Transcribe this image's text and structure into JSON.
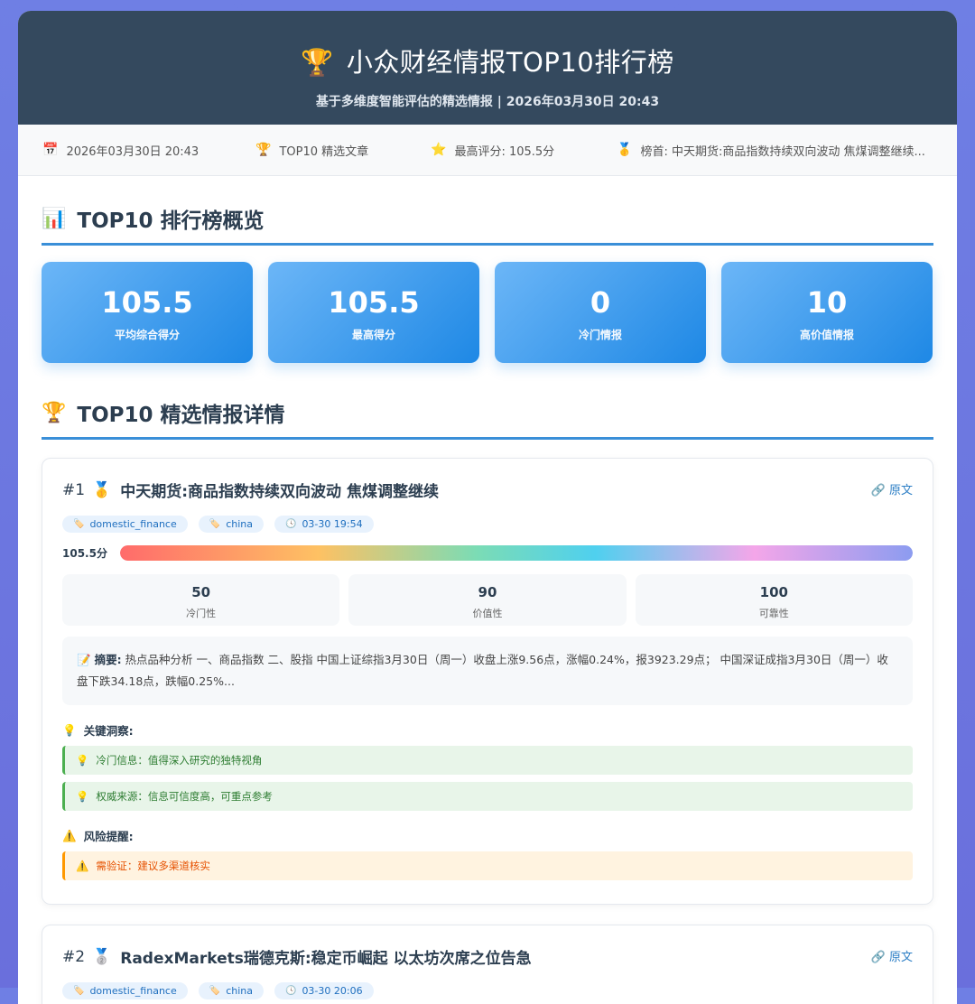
{
  "header": {
    "trophy_emoji": "🏆",
    "title": "小众财经情报TOP10排行榜",
    "subtitle": "基于多维度智能评估的精选情报 | 2026年03月30日 20:43"
  },
  "statbar": [
    {
      "icon": "📅",
      "icon_name": "calendar-icon",
      "text": "2026年03月30日 20:43"
    },
    {
      "icon": "🏆",
      "icon_name": "trophy-icon",
      "text": "TOP10 精选文章"
    },
    {
      "icon": "⭐",
      "icon_name": "star-icon",
      "text": "最高评分: 105.5分"
    },
    {
      "icon": "🥇",
      "icon_name": "medal-icon",
      "text": "榜首: 中天期货:商品指数持续双向波动 焦煤调整继续..."
    }
  ],
  "overview": {
    "icon": "📊",
    "title": "TOP10 排行榜概览",
    "cards": [
      {
        "value": "105.5",
        "label": "平均综合得分"
      },
      {
        "value": "105.5",
        "label": "最高得分"
      },
      {
        "value": "0",
        "label": "冷门情报"
      },
      {
        "value": "10",
        "label": "高价值情报"
      }
    ]
  },
  "details": {
    "icon": "🏆",
    "title": "TOP10 精选情报详情"
  },
  "articles": [
    {
      "rank": "#1",
      "medal": "🥇",
      "title": "中天期货:商品指数持续双向波动 焦煤调整继续",
      "link_label": "原文",
      "tags": [
        "domestic_finance",
        "china"
      ],
      "time": "03-30 19:54",
      "score_label": "105.5分",
      "score_fraction": 1.0,
      "metrics": [
        {
          "value": "50",
          "label": "冷门性"
        },
        {
          "value": "90",
          "label": "价值性"
        },
        {
          "value": "100",
          "label": "可靠性"
        }
      ],
      "summary_label": "摘要:",
      "summary": "热点品种分析 一、商品指数 二、股指 中国上证综指3月30日（周一）收盘上涨9.56点，涨幅0.24%，报3923.29点； 中国深证成指3月30日（周一）收盘下跌34.18点，跌幅0.25%...",
      "insights_title": "关键洞察:",
      "insights": [
        "冷门信息：值得深入研究的独特视角",
        "权威来源：信息可信度高，可重点参考"
      ],
      "risks_title": "风险提醒:",
      "risks": [
        "需验证：建议多渠道核实"
      ]
    },
    {
      "rank": "#2",
      "medal": "🥈",
      "title": "RadexMarkets瑞德克斯:稳定币崛起 以太坊次席之位告急",
      "link_label": "原文",
      "tags": [
        "domestic_finance",
        "china"
      ],
      "time": "03-30 20:06"
    }
  ],
  "colors": {
    "header_bg": "#34495e",
    "accent_blue": "#1e88e5",
    "insight_green": "#4caf50",
    "risk_orange": "#ff9800"
  }
}
